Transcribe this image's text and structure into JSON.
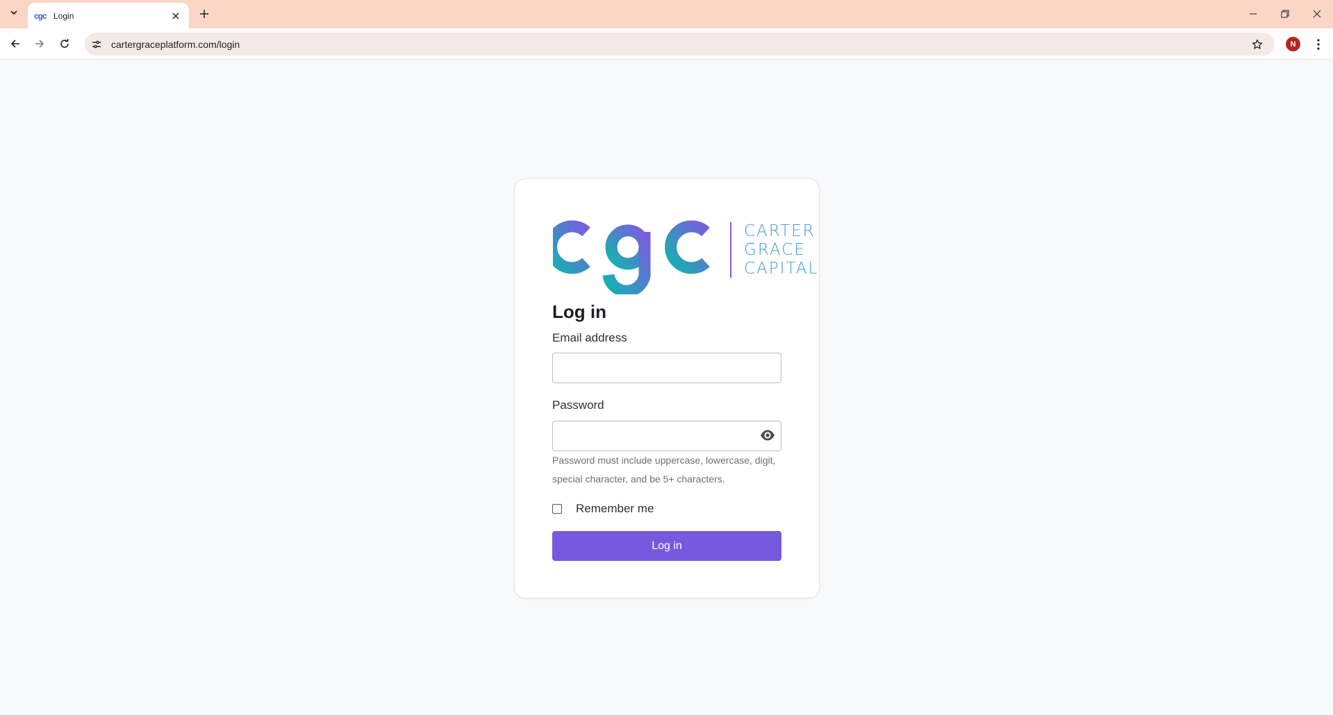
{
  "browser": {
    "tab_title": "Login",
    "tab_favicon_text": "cgc",
    "url": "cartergraceplatform.com/login",
    "profile_initial": "N"
  },
  "logo": {
    "mark": "cgc",
    "words": [
      "CARTER",
      "GRACE",
      "CAPITAL"
    ],
    "colors": {
      "mark_gradient_start": "#13b3b0",
      "mark_gradient_end": "#7b5ce0",
      "divider": "#8e5ad6",
      "words": "#3a9bd6"
    }
  },
  "login_form": {
    "heading": "Log in",
    "email_label": "Email address",
    "email_value": "",
    "password_label": "Password",
    "password_value": "",
    "password_hint": "Password must include uppercase, lowercase, digit, special character, and be 5+ characters.",
    "remember_label": "Remember me",
    "remember_checked": false,
    "submit_label": "Log in"
  },
  "theme": {
    "accent": "#7759de",
    "tabbar": "#fbd6c7",
    "page_background": "#f8f9fb"
  },
  "icons": [
    "tab-list-icon",
    "favicon-icon",
    "close-icon",
    "plus-icon",
    "minimize-icon",
    "restore-icon",
    "window-close-icon",
    "back-arrow-icon",
    "forward-arrow-icon",
    "reload-icon",
    "site-info-icon",
    "star-icon",
    "kebab-menu-icon",
    "eye-icon"
  ]
}
